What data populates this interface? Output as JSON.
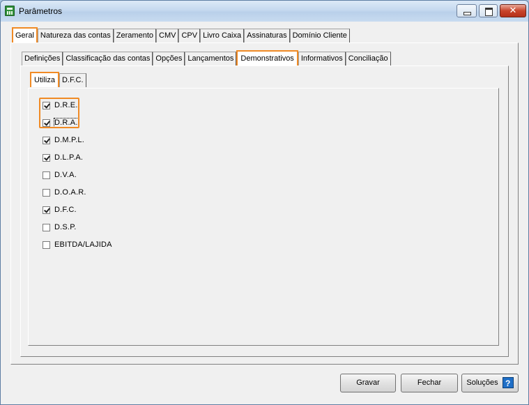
{
  "window": {
    "title": "Parâmetros"
  },
  "title_buttons": {
    "close": "✕"
  },
  "main_tabs": [
    {
      "label": "Geral",
      "active": true
    },
    {
      "label": "Natureza das contas"
    },
    {
      "label": "Zeramento"
    },
    {
      "label": "CMV"
    },
    {
      "label": "CPV"
    },
    {
      "label": "Livro Caixa"
    },
    {
      "label": "Assinaturas"
    },
    {
      "label": "Domínio Cliente"
    }
  ],
  "sub_tabs": [
    {
      "label": "Definições"
    },
    {
      "label": "Classificação das contas"
    },
    {
      "label": "Opções"
    },
    {
      "label": "Lançamentos"
    },
    {
      "label": "Demonstrativos",
      "active": true
    },
    {
      "label": "Informativos"
    },
    {
      "label": "Conciliação"
    }
  ],
  "inner_tabs": [
    {
      "label": "Utiliza",
      "active": true
    },
    {
      "label": "D.F.C."
    }
  ],
  "options": [
    {
      "label": "D.R.E.",
      "checked": true
    },
    {
      "label": "D.R.A.",
      "checked": true
    },
    {
      "label": "D.M.P.L.",
      "checked": true
    },
    {
      "label": "D.L.P.A.",
      "checked": true
    },
    {
      "label": "D.V.A.",
      "checked": false
    },
    {
      "label": "D.O.A.R.",
      "checked": false
    },
    {
      "label": "D.F.C.",
      "checked": true
    },
    {
      "label": "D.S.P.",
      "checked": false
    },
    {
      "label": "EBITDA/LAJIDA",
      "checked": false
    }
  ],
  "buttons": {
    "gravar": "Gravar",
    "fechar": "Fechar",
    "solucoes": "Soluções",
    "help_icon": "?"
  },
  "colors": {
    "highlight": "#f08a24",
    "help_icon": "#1f6fc7"
  }
}
